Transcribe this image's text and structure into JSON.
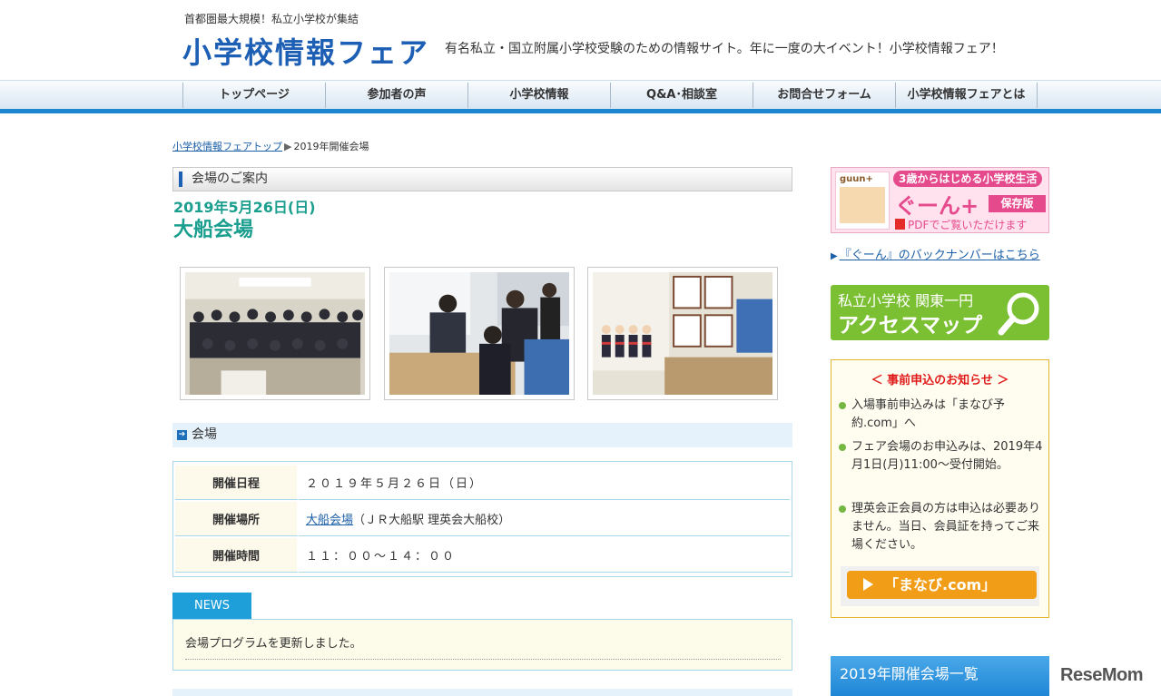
{
  "header": {
    "tagline": "首都圏最大規模！私立小学校が集結",
    "logo": "小学校情報フェア",
    "description": "有名私立・国立附属小学校受験のための情報サイト。年に一度の大イベント！小学校情報フェア！"
  },
  "nav": {
    "items": [
      {
        "label": "トップページ"
      },
      {
        "label": "参加者の声"
      },
      {
        "label": "小学校情報"
      },
      {
        "label": "Q&A･相談室"
      },
      {
        "label": "お問合せフォーム"
      },
      {
        "label": "小学校情報フェアとは"
      }
    ]
  },
  "breadcrumb": {
    "home": "小学校情報フェアトップ",
    "separator": "▶",
    "current": "2019年開催会場"
  },
  "main": {
    "section_title": "会場のご案内",
    "date": "2019年5月26日(日)",
    "venue_title": "大船会場",
    "subsection_title": "会場",
    "table": {
      "rows": [
        {
          "label": "開催日程",
          "value": "２０１９年５月２６日（日）"
        },
        {
          "label": "開催場所",
          "link": "大船会場",
          "value": "（ＪＲ大船駅 理英会大船校）"
        },
        {
          "label": "開催時間",
          "value": "１１：００～１４：００"
        }
      ]
    },
    "news": {
      "tab": "NEWS",
      "text": "会場プログラムを更新しました。"
    }
  },
  "sidebar": {
    "guun_banner": {
      "book_label": "guun+",
      "top_text": "3歳からはじめる小学校生活",
      "name": "ぐーん+",
      "badge": "保存版",
      "pdf_text": "PDFでご覧いただけます"
    },
    "backnumber_link": "『ぐーん』のバックナンバーはこちら",
    "access": {
      "line1": "私立小学校 関東一円",
      "line2": "アクセスマップ"
    },
    "notice": {
      "title": "＜ 事前申込のお知らせ ＞",
      "items": [
        "入場事前申込みは「まなび予約.com」へ",
        "フェア会場のお申込みは、2019年4月1日(月)11:00～受付開始。",
        "理英会正会員の方は申込は必要ありません。当日、会員証を持ってご来場ください。"
      ],
      "button": "「まなび.com」"
    },
    "list_header": "2019年開催会場一覧"
  },
  "watermark": "ReseMom",
  "colors": {
    "brand_blue": "#1d5fb4",
    "teal_heading": "#1a9e8e",
    "nav_accent": "#1c86d0",
    "news_blue": "#1f9fda",
    "access_green": "#7bbf33",
    "manabi_orange": "#f29d17",
    "notice_red": "#e01a1a"
  }
}
